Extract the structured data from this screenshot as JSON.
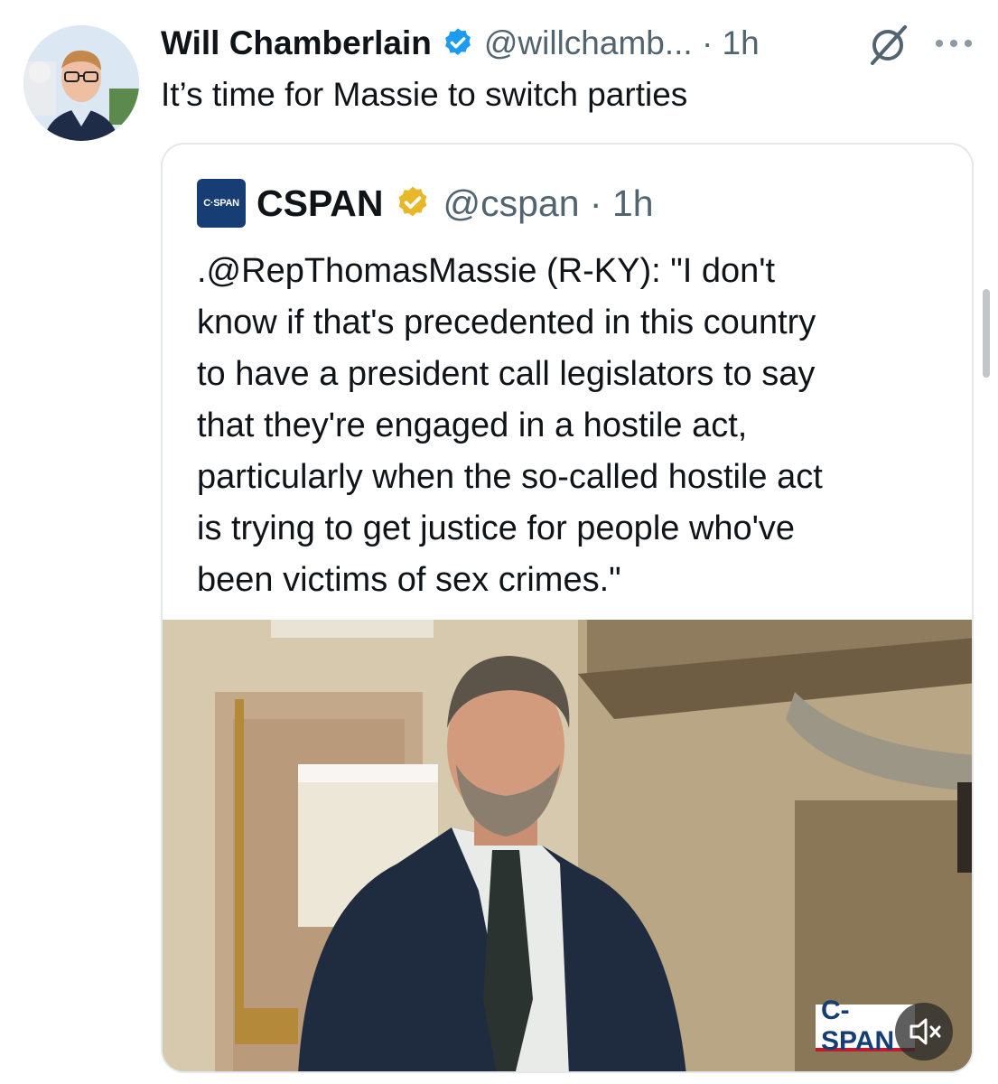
{
  "tweet": {
    "author_name": "Will Chamberlain",
    "handle_time": "@willchamb... · 1h",
    "text": "It’s time for Massie to switch parties",
    "verified_badge_color": "#1d9bf0",
    "icons": [
      "verified-badge-icon",
      "grok-icon",
      "more-icon"
    ]
  },
  "quote": {
    "logo_text": "C·SPAN",
    "name": "CSPAN",
    "handle_time": "@cspan · 1h",
    "badge_color": "#e8b82a",
    "text_lines": [
      ".@RepThomasMassie (R-KY): \"I don't",
      "know if that's precedented in this country",
      "to have a president call legislators to say",
      "that they're engaged in a hostile act,",
      "particularly when the so-called hostile act",
      "is trying to get justice for people who've",
      "been victims of sex crimes.\""
    ],
    "video": {
      "watermark": "C-SPAN",
      "icons": [
        "muted-speaker-icon"
      ]
    }
  }
}
